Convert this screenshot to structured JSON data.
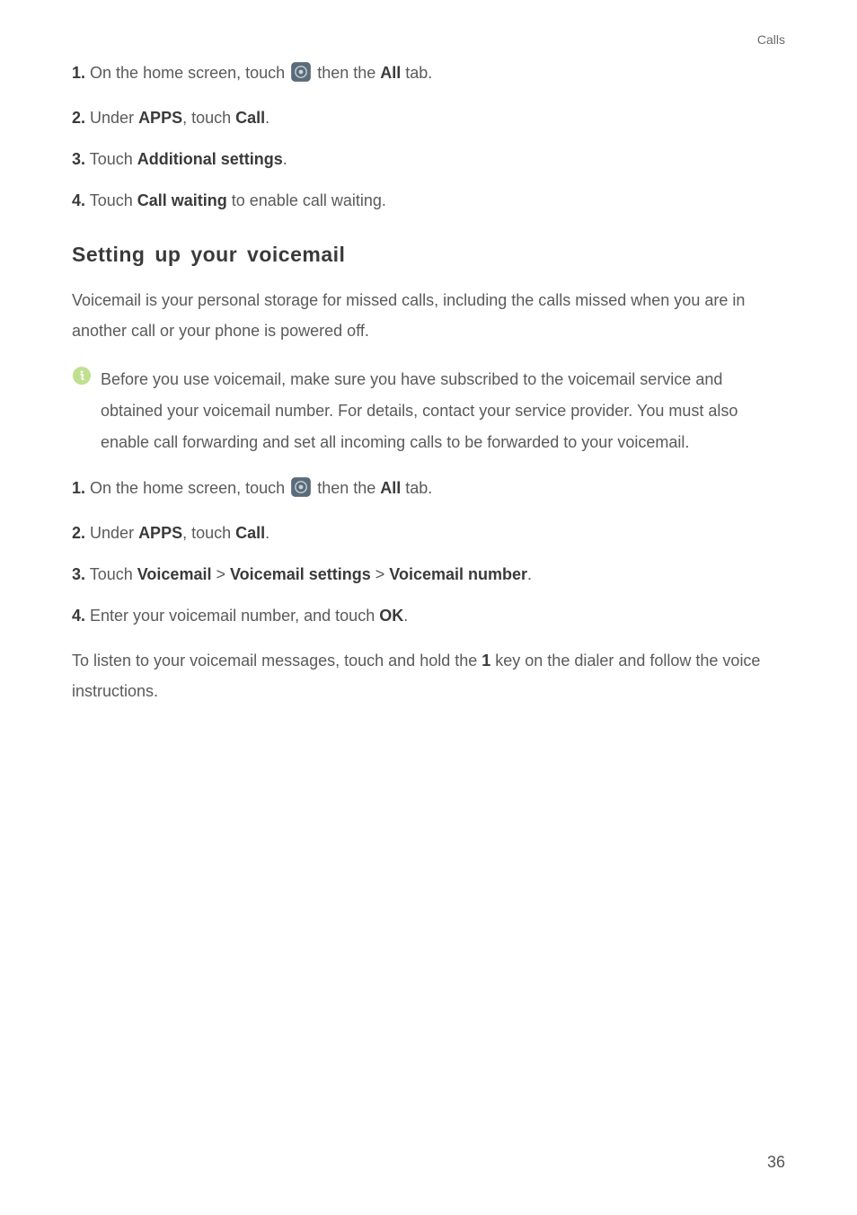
{
  "header": {
    "section_label": "Calls"
  },
  "block_a": {
    "steps": [
      {
        "num": "1.",
        "pre": "On the home screen, touch ",
        "post_pre": "then the ",
        "bold_post": "All",
        "tail": " tab."
      },
      {
        "num": "2.",
        "pre": "Under ",
        "bold1": "APPS",
        "mid": ", touch ",
        "bold2": "Call",
        "tail": "."
      },
      {
        "num": "3.",
        "pre": "Touch ",
        "bold1": "Additional settings",
        "tail": "."
      },
      {
        "num": "4.",
        "pre": "Touch ",
        "bold1": "Call waiting",
        "tail": " to enable call waiting."
      }
    ]
  },
  "heading": "Setting up your voicemail",
  "intro": "Voicemail is your personal storage for missed calls, including the calls missed when you are in another call or your phone is powered off.",
  "info_note": "Before you use voicemail, make sure you have subscribed to the voicemail service and obtained your voicemail number. For details, contact your service provider. You must also enable call forwarding and set all incoming calls to be forwarded to your voicemail.",
  "block_b": {
    "step1": {
      "num": "1.",
      "pre": "On the home screen, touch ",
      "post_pre": "then the ",
      "bold_post": "All",
      "tail": " tab."
    },
    "step2": {
      "num": "2.",
      "pre": "Under ",
      "bold1": "APPS",
      "mid": ", touch ",
      "bold2": "Call",
      "tail": "."
    },
    "step3": {
      "num": "3.",
      "pre": "Touch ",
      "b1": "Voicemail",
      "gt1": ">",
      "b2": "Voicemail settings",
      "gt2": ">",
      "b3": "Voicemail number",
      "tail": "."
    },
    "step4": {
      "num": "4.",
      "pre": "Enter your voicemail number, and touch ",
      "bold1": "OK",
      "tail": "."
    }
  },
  "closing_pre": "To listen to your voicemail messages, touch and hold the ",
  "closing_bold": "1",
  "closing_post": " key on the dialer and follow the voice instructions.",
  "page_number": "36"
}
